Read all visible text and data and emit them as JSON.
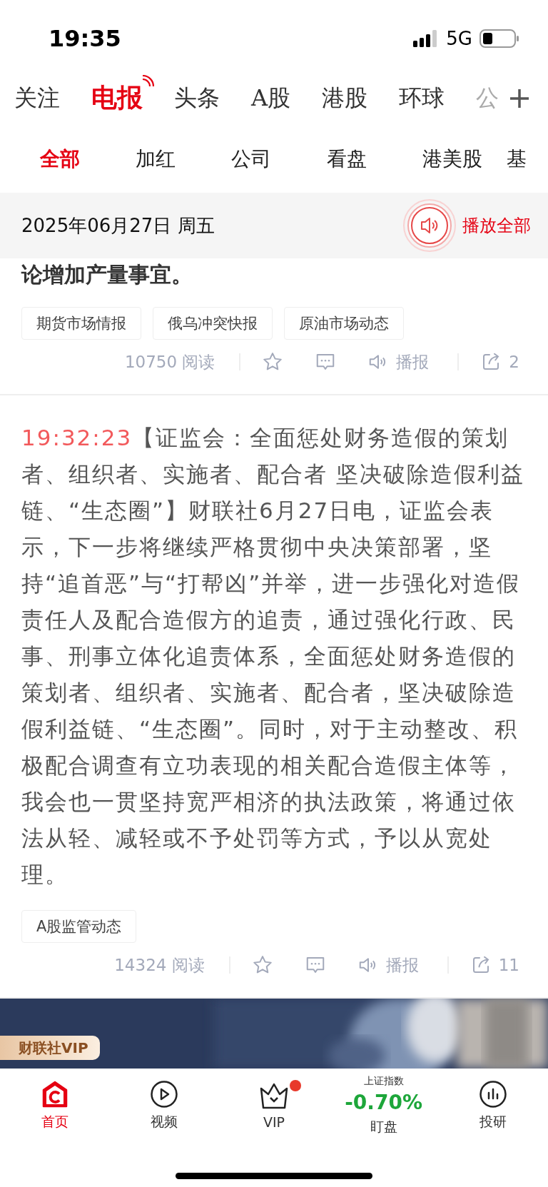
{
  "status_bar": {
    "time": "19:35",
    "network": "5G"
  },
  "channel_tabs": [
    {
      "label": "关注",
      "selected": false
    },
    {
      "label": "电报",
      "selected": true
    },
    {
      "label": "头条",
      "selected": false
    },
    {
      "label": "A股",
      "selected": false
    },
    {
      "label": "港股",
      "selected": false
    },
    {
      "label": "环球",
      "selected": false
    },
    {
      "label": "公",
      "selected": false
    }
  ],
  "sub_tabs": [
    {
      "label": "全部",
      "selected": true
    },
    {
      "label": "加红",
      "selected": false
    },
    {
      "label": "公司",
      "selected": false
    },
    {
      "label": "看盘",
      "selected": false
    },
    {
      "label": "港美股",
      "selected": false
    },
    {
      "label": "基",
      "selected": false
    }
  ],
  "date_bar": {
    "date": "2025年06月27日 周五",
    "play_all": "播放全部"
  },
  "feed": [
    {
      "kind": "partial",
      "text": "论增加产量事宜。",
      "tags": [
        "期货市场情报",
        "俄乌冲突快报",
        "原油市场动态"
      ],
      "reads": "10750",
      "read_label": "阅读",
      "listen_label": "播报",
      "shares": "2"
    },
    {
      "kind": "full",
      "time": "19:32:23",
      "text": "【证监会：全面惩处财务造假的策划者、组织者、实施者、配合者 坚决破除造假利益链、“生态圈”】财联社6月27日电，证监会表示，下一步将继续严格贯彻中央决策部署，坚持“追首恶”与“打帮凶”并举，进一步强化对造假责任人及配合造假方的追责，通过强化行政、民事、刑事立体化追责体系，全面惩处财务造假的策划者、组织者、实施者、配合者，坚决破除造假利益链、“生态圈”。同时，对于主动整改、积极配合调查有立功表现的相关配合造假主体等，我会也一贯坚持宽严相济的执法政策，将通过依法从轻、减轻或不予处罚等方式，予以从宽处理。",
      "tags": [
        "A股监管动态"
      ],
      "reads": "14324",
      "read_label": "阅读",
      "listen_label": "播报",
      "shares": "11"
    }
  ],
  "banner": {
    "kind": "picture",
    "badge": "财联社VIP"
  },
  "bottom_nav": [
    {
      "kind": "home",
      "label": "首页",
      "selected": true,
      "dot": false
    },
    {
      "kind": "video",
      "label": "视频",
      "selected": false,
      "dot": false
    },
    {
      "kind": "vip",
      "label": "VIP",
      "selected": false,
      "dot": true
    },
    {
      "kind": "index",
      "label": "盯盘",
      "selected": false,
      "dot": false,
      "index_name": "上证指数",
      "change": "-0.70%"
    },
    {
      "kind": "research",
      "label": "投研",
      "selected": false,
      "dot": false
    }
  ]
}
